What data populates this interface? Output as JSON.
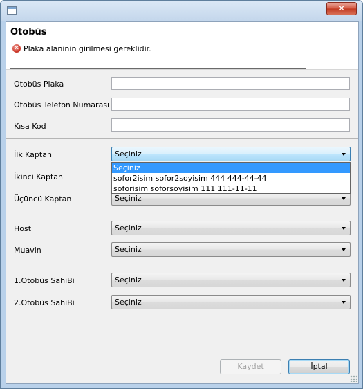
{
  "window": {
    "close_glyph": "✕"
  },
  "header": {
    "title": "Otobüs",
    "error_message": "Plaka alaninin girilmesi gereklidir."
  },
  "form": {
    "plaka_label": "Otobüs Plaka",
    "plaka_value": "",
    "telefon_label": "Otobüs Telefon Numarası",
    "telefon_value": "",
    "kisa_kod_label": "Kısa Kod",
    "kisa_kod_value": "",
    "ilk_kaptan_label": "İlk Kaptan",
    "ilk_kaptan_value": "Seçiniz",
    "ikinci_kaptan_label": "İkinci Kaptan",
    "ucuncu_kaptan_label": "Üçüncü Kaptan",
    "ucuncu_kaptan_value": "Seçiniz",
    "host_label": "Host",
    "host_value": "Seçiniz",
    "muavin_label": "Muavin",
    "muavin_value": "Seçiniz",
    "sahibi1_label": "1.Otobüs SahiBi",
    "sahibi1_value": "Seçiniz",
    "sahibi2_label": "2.Otobüs SahiBi",
    "sahibi2_value": "Seçiniz"
  },
  "dropdown": {
    "options": [
      {
        "label": "Seçiniz",
        "selected": true
      },
      {
        "label": "sofor2isim sofor2soyisim   444 444-44-44",
        "selected": false
      },
      {
        "label": "soforisim soforsoyisim   111 111-11-11",
        "selected": false
      }
    ]
  },
  "buttons": {
    "save_label": "Kaydet",
    "cancel_label": "İptal"
  }
}
